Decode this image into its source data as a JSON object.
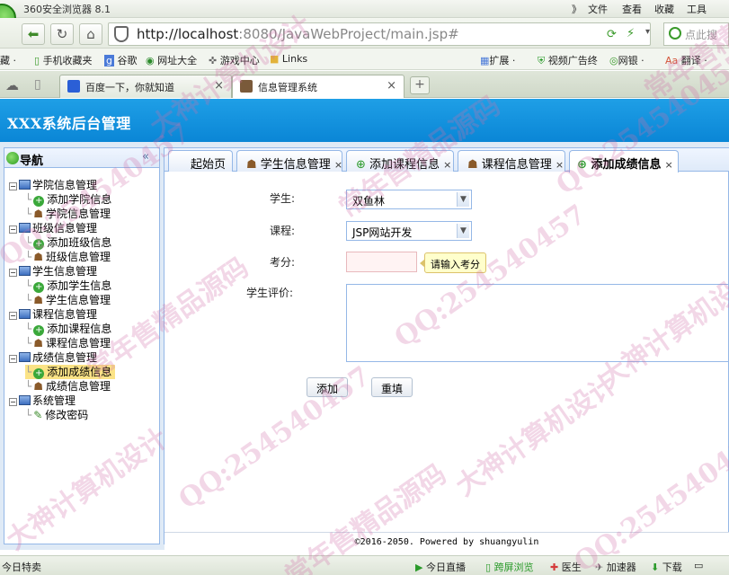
{
  "browser": {
    "app_title": "360安全浏览器 8.1",
    "menu": [
      "》",
      "文件",
      "查看",
      "收藏",
      "工具"
    ],
    "url_host": "http://localhost",
    "url_rest": ":8080/JavaWebProject/main.jsp#",
    "search_placeholder": "点此搜",
    "bookmarks": [
      "藏 ·",
      "手机收藏夹",
      "谷歌",
      "网址大全",
      "游戏中心",
      "Links"
    ],
    "right_tools": [
      "扩展 ·",
      "视频广告终",
      "网银 ·",
      "翻译 ·"
    ],
    "tabs": [
      {
        "label": "百度一下，你就知道",
        "close": "×"
      },
      {
        "label": "信息管理系统",
        "close": "×"
      }
    ],
    "status_left": "今日特卖",
    "status_right": [
      "今日直播",
      "跨屏浏览",
      "医生",
      "加速器",
      "下载"
    ]
  },
  "header": {
    "title": "XXX系统后台管理"
  },
  "nav": {
    "title": "导航",
    "collapse": "«",
    "groups": [
      {
        "label": "学院信息管理",
        "items": [
          "添加学院信息",
          "学院信息管理"
        ]
      },
      {
        "label": "班级信息管理",
        "items": [
          "添加班级信息",
          "班级信息管理"
        ]
      },
      {
        "label": "学生信息管理",
        "items": [
          "添加学生信息",
          "学生信息管理"
        ]
      },
      {
        "label": "课程信息管理",
        "items": [
          "添加课程信息",
          "课程信息管理"
        ]
      },
      {
        "label": "成绩信息管理",
        "items": [
          "添加成绩信息",
          "成绩信息管理"
        ]
      },
      {
        "label": "系统管理",
        "items": [
          "修改密码"
        ]
      }
    ],
    "selected": "添加成绩信息"
  },
  "content_tabs": [
    {
      "label": "起始页"
    },
    {
      "label": "学生信息管理",
      "close": "×"
    },
    {
      "label": "添加课程信息",
      "close": "×"
    },
    {
      "label": "课程信息管理",
      "close": "×"
    },
    {
      "label": "添加成绩信息",
      "close": "×",
      "active": true
    }
  ],
  "form": {
    "student_label": "学生:",
    "student_value": "双鱼林",
    "course_label": "课程:",
    "course_value": "JSP网站开发",
    "score_label": "考分:",
    "score_value": "",
    "score_tooltip": "请输入考分",
    "comment_label": "学生评价:",
    "comment_value": "",
    "add_button": "添加",
    "reset_button": "重填"
  },
  "footer": {
    "text": "©2016-2050. Powered by shuangyulin"
  },
  "watermark": {
    "texts": [
      "大神计算机设计",
      "QQ:254540457",
      "常年售精品源码"
    ]
  },
  "colors": {
    "header": "#0f8ad9",
    "panel_border": "#95b8e7",
    "selected": "#fbe386",
    "tooltip": "#ffffcc"
  }
}
